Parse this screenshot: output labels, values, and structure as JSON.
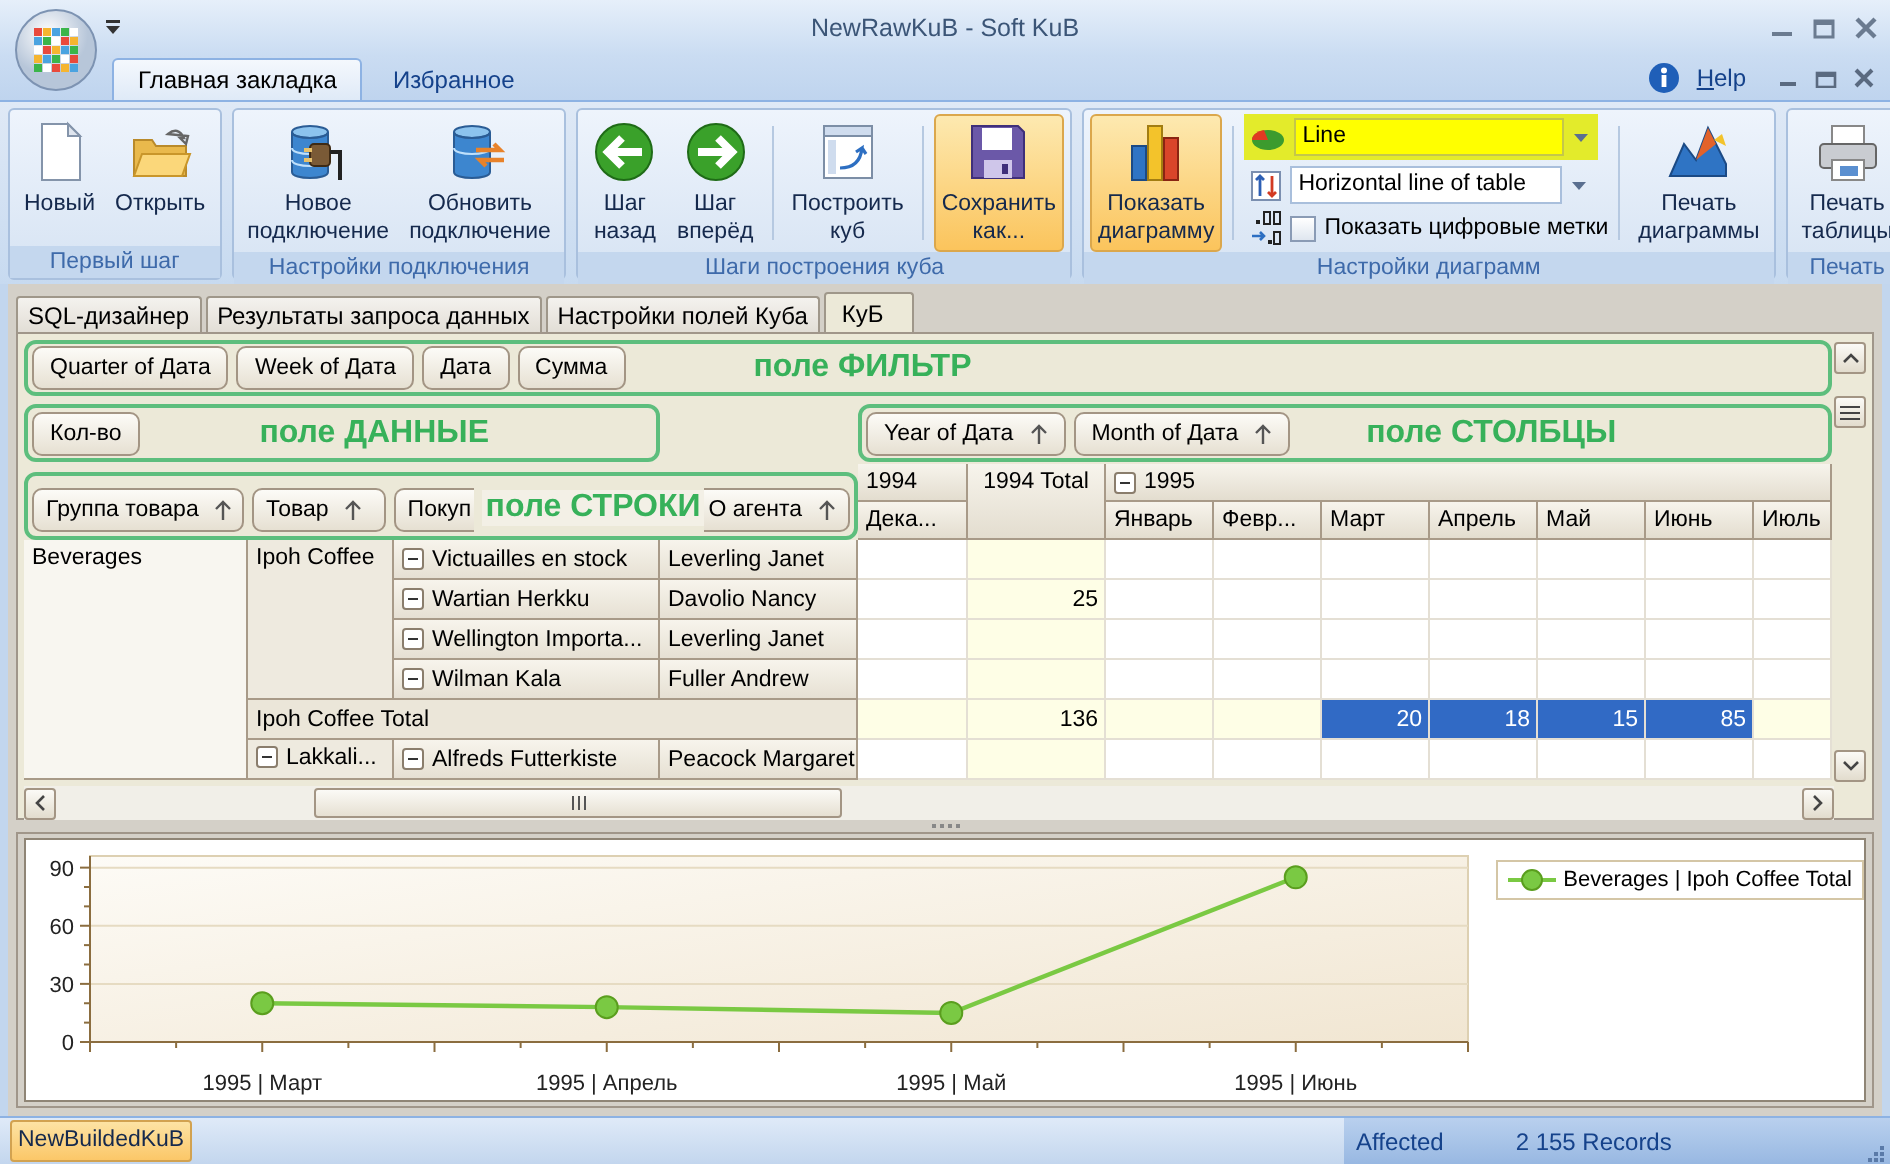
{
  "window": {
    "title": "NewRawKuB - Soft KuB"
  },
  "ribbon_tabs": [
    {
      "label": "Главная закладка",
      "selected": true
    },
    {
      "label": "Избранное",
      "selected": false
    }
  ],
  "help": {
    "label": "Help"
  },
  "ribbon_groups": [
    {
      "title": "Первый шаг",
      "items": [
        {
          "kind": "button",
          "label": "Новый",
          "highlighted": false
        },
        {
          "kind": "button",
          "label": "Открыть",
          "highlighted": false
        }
      ]
    },
    {
      "title": "Настройки подключения",
      "items": [
        {
          "kind": "button",
          "label": "Новое\nподключение",
          "highlighted": false
        },
        {
          "kind": "button",
          "label": "Обновить\nподключение",
          "highlighted": false
        }
      ]
    },
    {
      "title": "Шаги построения куба",
      "items": [
        {
          "kind": "button",
          "label": "Шаг\nназад",
          "highlighted": false
        },
        {
          "kind": "button",
          "label": "Шаг\nвперёд",
          "highlighted": false
        },
        {
          "kind": "separator"
        },
        {
          "kind": "button",
          "label": "Построить\nкуб",
          "highlighted": false
        },
        {
          "kind": "separator"
        },
        {
          "kind": "button",
          "label": "Сохранить\nкак...",
          "highlighted": true
        }
      ]
    },
    {
      "title": "Настройки диаграмм",
      "items": [
        {
          "kind": "button",
          "label": "Показать\nдиаграмму",
          "highlighted": true
        },
        {
          "kind": "separator"
        },
        {
          "kind": "options",
          "combos": [
            {
              "value": "Line",
              "highlighted": true
            },
            {
              "value": "Horizontal line of table",
              "highlighted": false
            }
          ],
          "checkbox": {
            "label": "Показать цифровые метки",
            "checked": false
          }
        },
        {
          "kind": "separator"
        },
        {
          "kind": "button",
          "label": "Печать\nдиаграммы",
          "highlighted": false
        }
      ]
    },
    {
      "title": "Печать",
      "items": [
        {
          "kind": "button",
          "label": "Печать\nтаблицы",
          "highlighted": false
        }
      ]
    }
  ],
  "doc_tabs": [
    {
      "label": "SQL-дизайнер",
      "selected": false
    },
    {
      "label": "Результаты запроса данных",
      "selected": false
    },
    {
      "label": "Настройки полей Куба",
      "selected": false
    },
    {
      "label": "КуБ",
      "selected": true
    }
  ],
  "pivot": {
    "filter_area": {
      "label": "поле ФИЛЬТР",
      "fields": [
        {
          "text": "Quarter of Дата",
          "sorted": false
        },
        {
          "text": "Week of Дата",
          "sorted": false
        },
        {
          "text": "Дата",
          "sorted": false
        },
        {
          "text": "Сумма",
          "sorted": false
        }
      ]
    },
    "data_area": {
      "label": "поле ДАННЫЕ",
      "fields": [
        {
          "text": "Кол-во",
          "sorted": false
        }
      ]
    },
    "column_area": {
      "label": "поле СТОЛБЦЫ",
      "fields": [
        {
          "text": "Year of Дата",
          "sorted": true
        },
        {
          "text": "Month of Дата",
          "sorted": true
        }
      ]
    },
    "row_area": {
      "label": "поле СТРОКИ",
      "fields": [
        {
          "text": "Группа товара",
          "sorted": true
        },
        {
          "text": "Товар",
          "sorted": true
        },
        {
          "text": "Покуп",
          "sorted": false
        },
        {
          "text": "О агента",
          "sorted": true
        }
      ]
    },
    "column_headers": [
      {
        "text": "1994",
        "kind": "year",
        "expander": false,
        "months": [
          "Дека..."
        ]
      },
      {
        "text": "1994 Total",
        "kind": "total",
        "expander": false
      },
      {
        "text": "1995",
        "kind": "year",
        "expander": true,
        "months": [
          "Январь",
          "Февр...",
          "Март",
          "Апрель",
          "Май",
          "Июнь",
          "Июль"
        ]
      }
    ],
    "row_groups": [
      {
        "text": "Beverages",
        "products": [
          {
            "text": "Ipoh Coffee",
            "expander": false,
            "customers": [
              {
                "text": "Victuailles en stock",
                "expander": true,
                "agent": "Leverling Janet",
                "cells": [
                  {
                    "selected": false
                  },
                  {
                    "selected": false
                  },
                  {
                    "selected": false
                  },
                  {
                    "selected": false
                  },
                  {
                    "selected": false
                  },
                  {
                    "selected": false
                  },
                  {
                    "selected": false
                  },
                  {
                    "selected": false
                  },
                  {
                    "selected": false
                  }
                ]
              },
              {
                "text": "Wartian Herkku",
                "expander": true,
                "agent": "Davolio Nancy",
                "cells": [
                  {
                    "selected": false
                  },
                  {
                    "value": "25",
                    "selected": false
                  },
                  {
                    "selected": false
                  },
                  {
                    "selected": false
                  },
                  {
                    "selected": false
                  },
                  {
                    "selected": false
                  },
                  {
                    "selected": false
                  },
                  {
                    "selected": false
                  },
                  {
                    "selected": false
                  }
                ]
              },
              {
                "text": "Wellington Importa...",
                "expander": true,
                "agent": "Leverling Janet",
                "cells": [
                  {
                    "selected": false
                  },
                  {
                    "selected": false
                  },
                  {
                    "selected": false
                  },
                  {
                    "selected": false
                  },
                  {
                    "selected": false
                  },
                  {
                    "selected": false
                  },
                  {
                    "selected": false
                  },
                  {
                    "selected": false
                  },
                  {
                    "selected": false
                  }
                ]
              },
              {
                "text": "Wilman Kala",
                "expander": true,
                "agent": "Fuller Andrew",
                "cells": [
                  {
                    "selected": false
                  },
                  {
                    "selected": false
                  },
                  {
                    "selected": false
                  },
                  {
                    "selected": false
                  },
                  {
                    "selected": false
                  },
                  {
                    "selected": false
                  },
                  {
                    "selected": false
                  },
                  {
                    "selected": false
                  },
                  {
                    "selected": false
                  }
                ]
              }
            ],
            "total": {
              "text": "Ipoh Coffee Total",
              "cells": [
                {
                  "selected": false
                },
                {
                  "value": "136",
                  "selected": false
                },
                {
                  "selected": false
                },
                {
                  "selected": false
                },
                {
                  "value": "20",
                  "selected": true
                },
                {
                  "value": "18",
                  "selected": true
                },
                {
                  "value": "15",
                  "selected": true
                },
                {
                  "value": "85",
                  "selected": true
                },
                {
                  "selected": false
                }
              ]
            }
          },
          {
            "text": "Lakkali...",
            "expander": true,
            "customers": [
              {
                "text": "Alfreds Futterkiste",
                "expander": true,
                "agent": "Peacock Margaret",
                "cells": [
                  {
                    "selected": false
                  },
                  {
                    "selected": false
                  },
                  {
                    "selected": false
                  },
                  {
                    "selected": false
                  },
                  {
                    "selected": false
                  },
                  {
                    "selected": false
                  },
                  {
                    "selected": false
                  },
                  {
                    "selected": false
                  },
                  {
                    "selected": false
                  }
                ]
              }
            ]
          }
        ]
      }
    ]
  },
  "chart": {
    "chart_data": {
      "type": "line",
      "categories": [
        "1995 | Март",
        "1995 | Апрель",
        "1995 | Май",
        "1995 | Июнь"
      ],
      "series": [
        {
          "name": "Beverages | Ipoh Coffee Total",
          "color": "#7ac943",
          "marker": "circle",
          "values": [
            20,
            18,
            15,
            85
          ]
        }
      ],
      "ylim": [
        0,
        96
      ],
      "yticks": [
        0,
        30,
        60,
        90
      ],
      "grid": true
    }
  },
  "status_bar": {
    "tab": "NewBuildedKuB",
    "label": "Affected",
    "records": "2 155 Records"
  }
}
